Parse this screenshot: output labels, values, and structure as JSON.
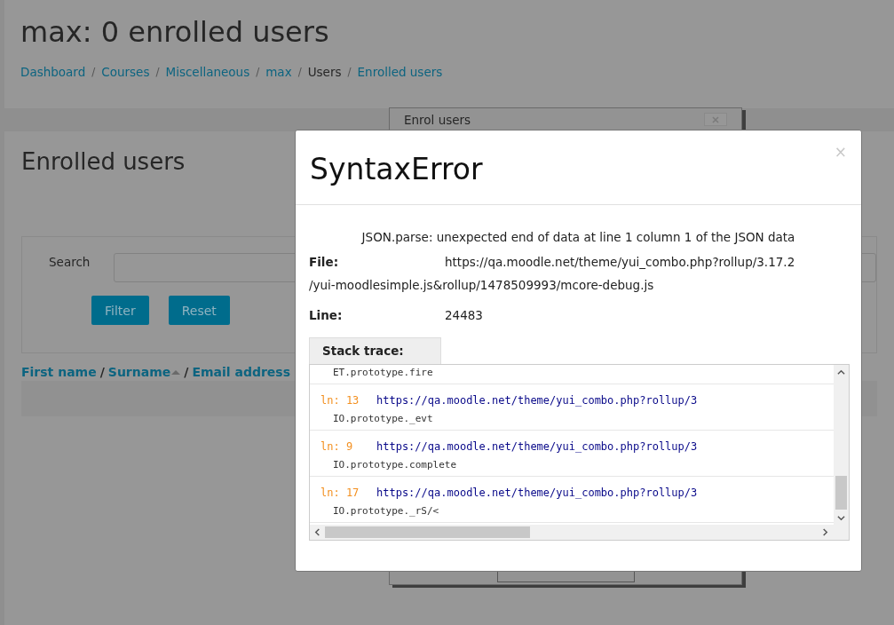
{
  "page": {
    "title": "max: 0 enrolled users",
    "breadcrumb": [
      {
        "label": "Dashboard",
        "link": true
      },
      {
        "label": "Courses",
        "link": true
      },
      {
        "label": "Miscellaneous",
        "link": true
      },
      {
        "label": "max",
        "link": true
      },
      {
        "label": "Users",
        "link": false
      },
      {
        "label": "Enrolled users",
        "link": true
      }
    ],
    "separator": "/"
  },
  "enrolled": {
    "heading": "Enrolled users",
    "search_label": "Search",
    "buttons": [
      "Filter",
      "Reset"
    ],
    "columns": [
      {
        "label": "First name",
        "sorted": false
      },
      {
        "label": "Surname",
        "sorted": true
      },
      {
        "label": "Email address",
        "sorted": false
      }
    ],
    "column_separator": "/"
  },
  "enrol_dialog": {
    "title": "Enrol users"
  },
  "error_dialog": {
    "title": "SyntaxError",
    "close": "×",
    "message": "JSON.parse: unexpected end of data at line 1 column 1 of the JSON data",
    "fields": [
      {
        "label": "File:",
        "value_lines": [
          "https://qa.moodle.net/theme/yui_combo.php?rollup/3.17.2",
          "/yui-moodlesimple.js&rollup/1478509993/mcore-debug.js"
        ]
      },
      {
        "label": "Line:",
        "value_lines": [
          "24483"
        ]
      }
    ],
    "stack_trace": {
      "label": "Stack trace:",
      "entries": [
        {
          "function": "ET.prototype.fire"
        },
        {
          "line": "ln: 13",
          "url": "https://qa.moodle.net/theme/yui_combo.php?rollup/3",
          "function": "IO.prototype._evt"
        },
        {
          "line": "ln: 9",
          "url": "https://qa.moodle.net/theme/yui_combo.php?rollup/3",
          "function": "IO.prototype.complete"
        },
        {
          "line": "ln: 17",
          "url": "https://qa.moodle.net/theme/yui_combo.php?rollup/3",
          "function": "IO.prototype._rS/<"
        }
      ]
    }
  }
}
